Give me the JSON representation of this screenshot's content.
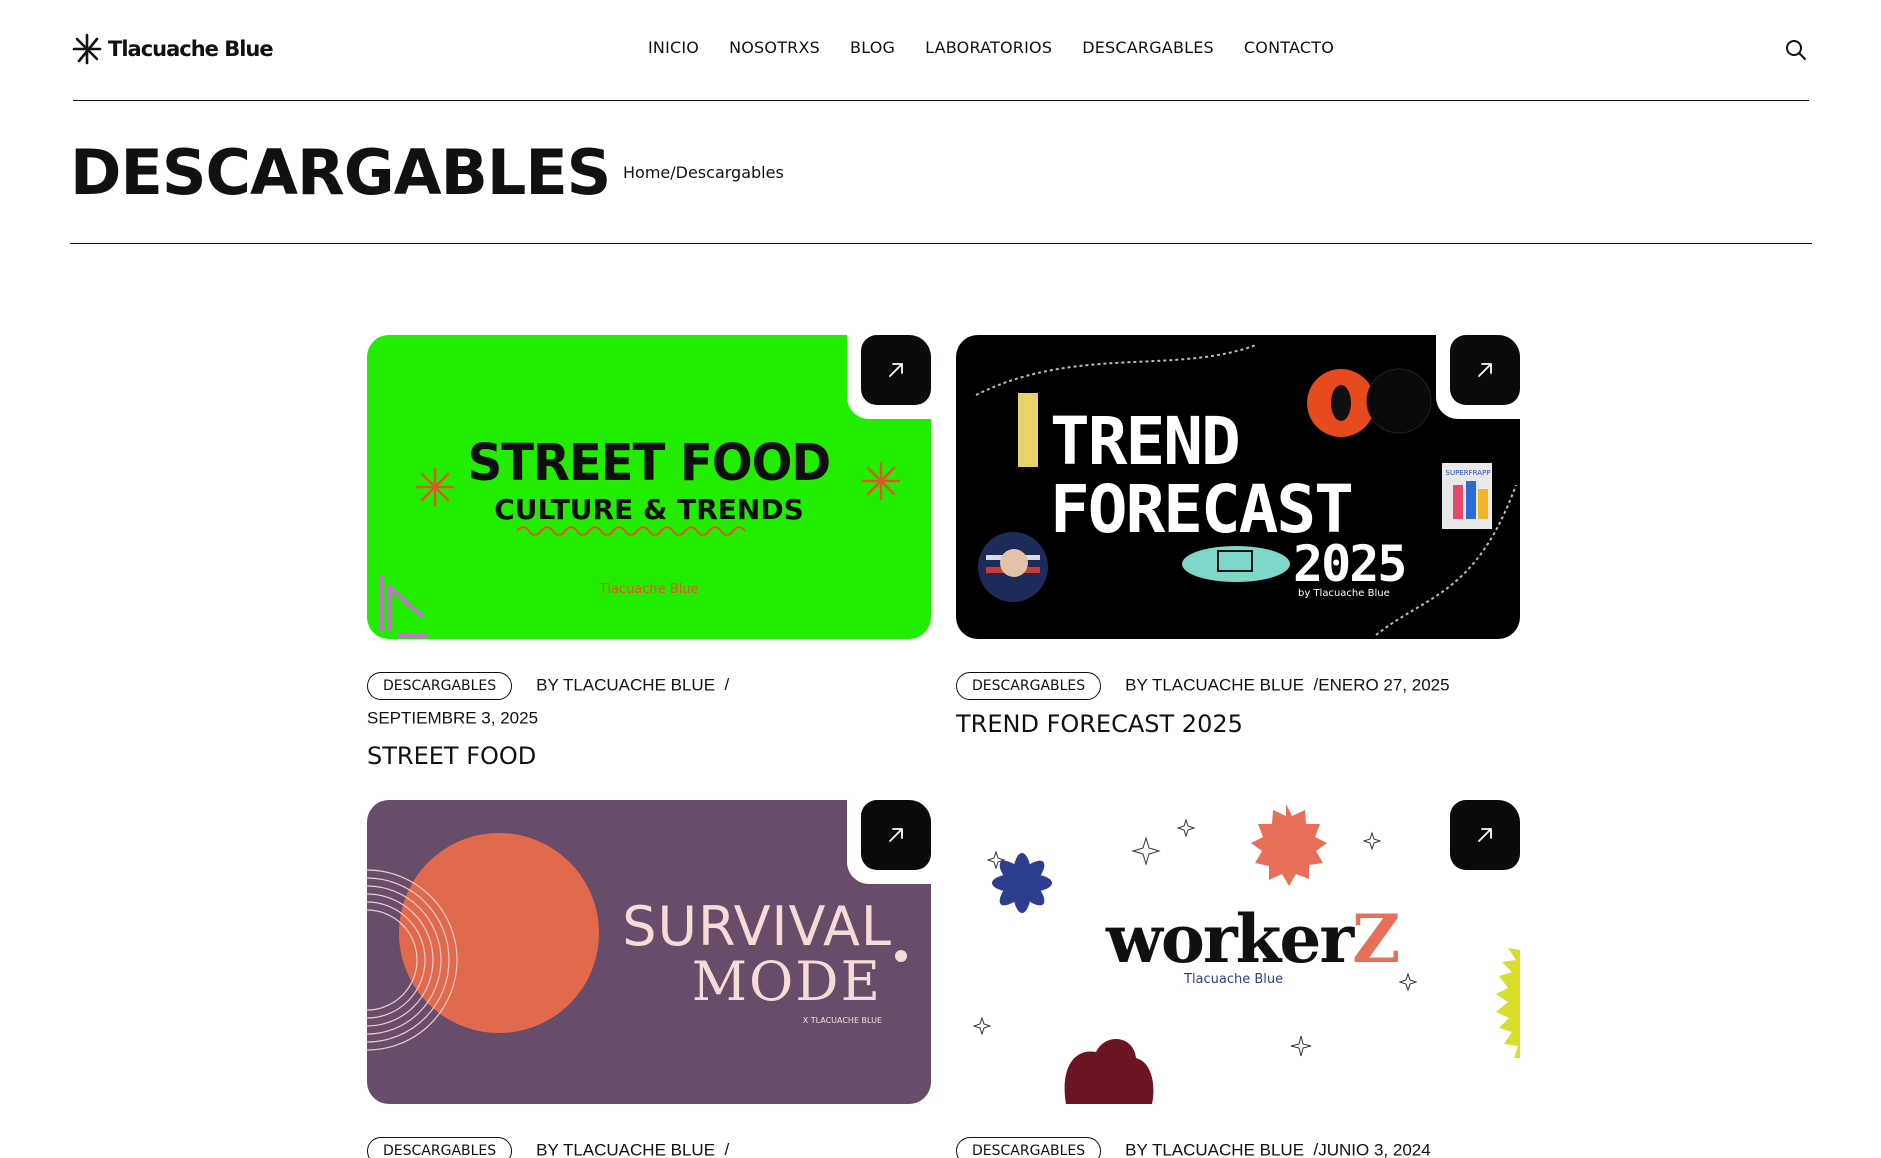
{
  "brand": {
    "name": "Tlacuache Blue"
  },
  "nav": {
    "items": [
      "INICIO",
      "NOSOTRXS",
      "BLOG",
      "LABORATORIOS",
      "DESCARGABLES",
      "CONTACTO"
    ]
  },
  "page": {
    "title": "DESCARGABLES",
    "breadcrumb_home": "Home",
    "breadcrumb_sep": "/",
    "breadcrumb_current": "Descargables"
  },
  "cards": [
    {
      "tag": "DESCARGABLES",
      "author": "BY TLACUACHE BLUE",
      "sep": "/",
      "date": "SEPTIEMBRE 3, 2025",
      "title": "STREET FOOD",
      "thumb": {
        "line1": "STREET FOOD",
        "line2": "CULTURE & TRENDS",
        "brand": "Tlacuache Blue",
        "bg": "#22ec00"
      }
    },
    {
      "tag": "DESCARGABLES",
      "author": "BY TLACUACHE BLUE",
      "sep": "/",
      "date": "ENERO 27, 2025",
      "title": "TREND FORECAST 2025",
      "thumb": {
        "line1": "TREND",
        "line2": "FORECAST",
        "line3": "2025",
        "by": "by",
        "brand": "Tlacuache Blue",
        "book": "SUPERFRAPP",
        "bg": "#000000"
      }
    },
    {
      "tag": "DESCARGABLES",
      "author": "BY TLACUACHE BLUE",
      "sep": "/",
      "date": "",
      "title": "",
      "thumb": {
        "line1": "SURVIVAL",
        "line2": "MODE",
        "brand": "X TLACUACHE BLUE",
        "bg": "#684d6b"
      }
    },
    {
      "tag": "DESCARGABLES",
      "author": "BY TLACUACHE BLUE",
      "sep": "/",
      "date": "JUNIO 3, 2024",
      "title": "",
      "thumb": {
        "line1": "worker",
        "line1b": "Z",
        "brand": "Tlacuache Blue",
        "bg": "#ffffff"
      }
    }
  ],
  "icons": {
    "logo": "asterisk-logo-icon",
    "search": "search-icon",
    "arrow": "arrow-up-right-icon"
  }
}
